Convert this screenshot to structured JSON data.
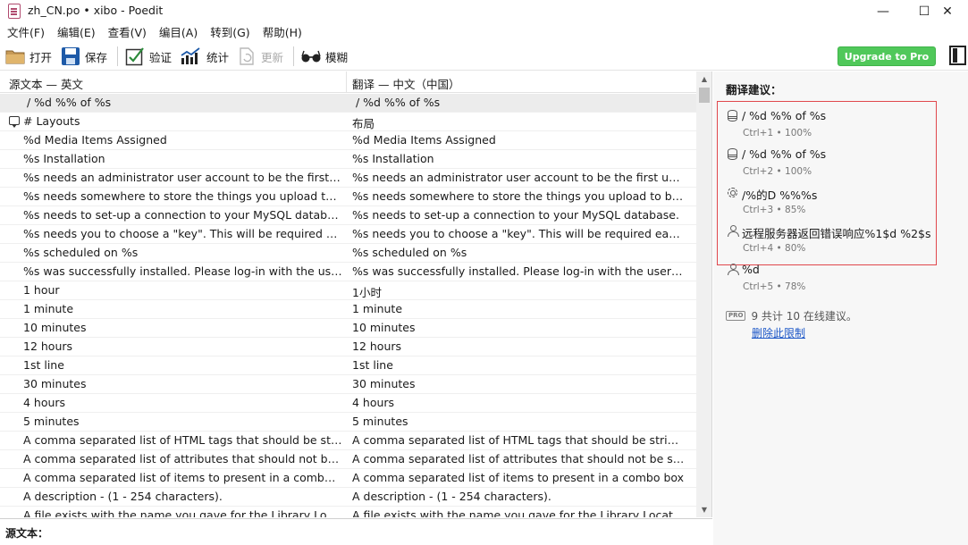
{
  "window": {
    "title": "zh_CN.po • xibo - Poedit",
    "minimize": "—",
    "maximize": "☐",
    "close": "✕"
  },
  "menu": [
    "文件(F)",
    "编辑(E)",
    "查看(V)",
    "编目(A)",
    "转到(G)",
    "帮助(H)"
  ],
  "toolbar": {
    "open": "打开",
    "save": "保存",
    "validate": "验证",
    "stats": "统计",
    "update": "更新",
    "fuzzy": "模糊",
    "upgrade": "Upgrade to Pro"
  },
  "list": {
    "source_header": "源文本 — 英文",
    "translation_header": "翻译 — 中文（中国）",
    "rows": [
      {
        "source": "/ %d %% of %s",
        "translation": "/ %d %% of %s"
      },
      {
        "source": "# Layouts",
        "translation": "布局"
      },
      {
        "source": "%d Media Items Assigned",
        "translation": "%d Media Items Assigned"
      },
      {
        "source": "%s Installation",
        "translation": "%s Installation"
      },
      {
        "source": "%s needs an administrator user account to be the first user account",
        "translation": "%s needs an administrator user account to be the first user account"
      },
      {
        "source": "%s needs somewhere to store the things you upload to be shown",
        "translation": "%s needs somewhere to store the things you upload to be shown"
      },
      {
        "source": "%s needs to set-up a connection to your MySQL database.",
        "translation": "%s needs to set-up a connection to your MySQL database."
      },
      {
        "source": "%s needs you to choose a \"key\". This will be required each time",
        "translation": "%s needs you to choose a \"key\". This will be required each time"
      },
      {
        "source": "%s scheduled on %s",
        "translation": "%s scheduled on %s"
      },
      {
        "source": "%s was successfully installed. Please log-in with the user details",
        "translation": "%s was successfully installed. Please log-in with the user details"
      },
      {
        "source": "1 hour",
        "translation": "1小时"
      },
      {
        "source": "1 minute",
        "translation": "1 minute"
      },
      {
        "source": "10 minutes",
        "translation": "10 minutes"
      },
      {
        "source": "12 hours",
        "translation": "12 hours"
      },
      {
        "source": "1st line",
        "translation": "1st line"
      },
      {
        "source": "30 minutes",
        "translation": "30 minutes"
      },
      {
        "source": "4 hours",
        "translation": "4 hours"
      },
      {
        "source": "5 minutes",
        "translation": "5 minutes"
      },
      {
        "source": "A comma separated list of HTML tags that should be stripped",
        "translation": "A comma separated list of HTML tags that should be stripped"
      },
      {
        "source": "A comma separated list of attributes that should not be stripped",
        "translation": "A comma separated list of attributes that should not be stripped"
      },
      {
        "source": "A comma separated list of items to present in a combo box",
        "translation": "A comma separated list of items to present in a combo box"
      },
      {
        "source": "A description - (1 - 254 characters).",
        "translation": "A description - (1 - 254 characters)."
      },
      {
        "source": "A file exists with the name you gave for the Library Location",
        "translation": "A file exists with the name you gave for the Library Location. Pl"
      }
    ]
  },
  "bottom": {
    "source_label": "源文本："
  },
  "suggestions": {
    "title": "翻译建议：",
    "items": [
      {
        "text": "/ %d %% of %s",
        "meta": "Ctrl+1 • 100%",
        "icon": "database-icon"
      },
      {
        "text": "/ %d %% of %s",
        "meta": "Ctrl+2 • 100%",
        "icon": "database-icon"
      },
      {
        "text": "/%的D %%%s",
        "meta": "Ctrl+3 • 85%",
        "icon": "gear-icon"
      },
      {
        "text": "远程服务器返回错误响应%1$d %2$s",
        "meta": "Ctrl+4 • 80%",
        "icon": "user-icon"
      },
      {
        "text": "%d",
        "meta": "Ctrl+5 • 78%",
        "icon": "user-icon"
      }
    ],
    "pro_badge": "PRO",
    "pro_text": "9 共计 10 在线建议。",
    "remove_limit": "删除此限制"
  },
  "colors": {
    "highlight_border": "#e0474c",
    "upgrade_bg": "#50c85a",
    "link": "#1b56c7"
  }
}
